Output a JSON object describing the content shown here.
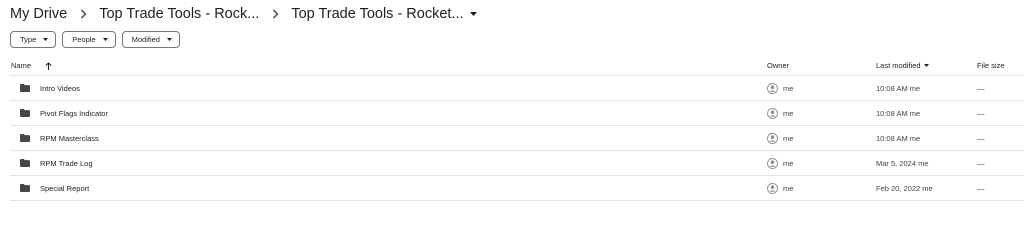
{
  "breadcrumb": {
    "items": [
      "My Drive",
      "Top Trade Tools - Rock...",
      "Top Trade Tools - Rocket..."
    ]
  },
  "filters": [
    "Type",
    "People",
    "Modified"
  ],
  "columns": {
    "name": "Name",
    "owner": "Owner",
    "modified": "Last modified",
    "size": "File size"
  },
  "rows": [
    {
      "name": "Intro Videos",
      "owner": "me",
      "modified": "10:08 AM me",
      "size": "—"
    },
    {
      "name": "Pivot Flags Indicator",
      "owner": "me",
      "modified": "10:08 AM me",
      "size": "—"
    },
    {
      "name": "RPM Masterclass",
      "owner": "me",
      "modified": "10:08 AM me",
      "size": "—"
    },
    {
      "name": "RPM Trade Log",
      "owner": "me",
      "modified": "Mar 5, 2024 me",
      "size": "—"
    },
    {
      "name": "Special Report",
      "owner": "me",
      "modified": "Feb 20, 2022 me",
      "size": "—"
    }
  ],
  "icons": {
    "breadcrumb_separator": "chevron-right-icon",
    "dropdown": "caret-down-icon",
    "sort": "arrow-up-icon",
    "folder": "folder-icon",
    "owner": "account-circle-icon"
  },
  "colors": {
    "text": "#1f1f1f",
    "secondary_text": "#444746",
    "divider": "#e3e3e3",
    "chip_border": "#747775",
    "folder_icon": "#444746",
    "avatar_icon": "#8e918f"
  }
}
